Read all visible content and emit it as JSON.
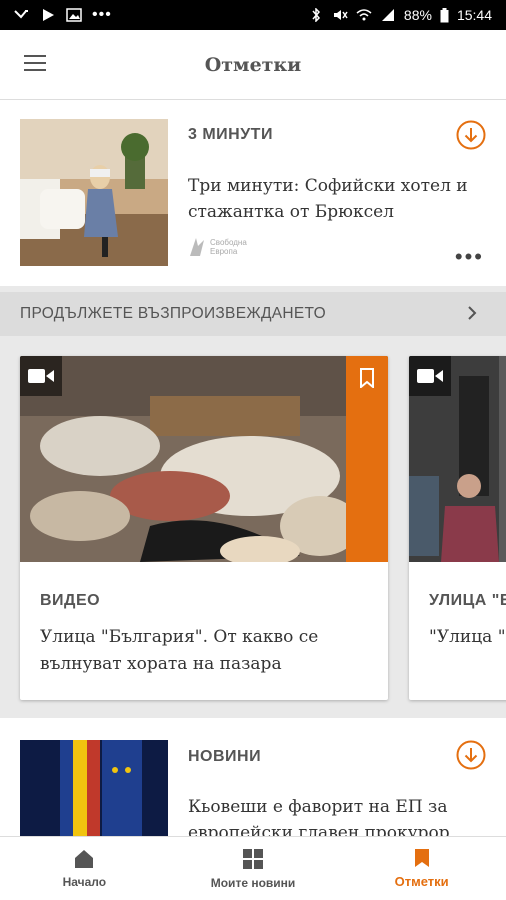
{
  "status_bar": {
    "battery": "88%",
    "time": "15:44"
  },
  "app_bar": {
    "title": "Отметки"
  },
  "first_story": {
    "category": "3 МИНУТИ",
    "title": "Три минути: Софийски хотел и стажантка от Брюксел",
    "source_line1": "Свободна",
    "source_line2": "Европа"
  },
  "continue_bar": {
    "label": "ПРОДЪЛЖЕТЕ ВЪЗПРОИЗВЕЖДАНЕТО"
  },
  "carousel": {
    "cards": [
      {
        "category": "ВИДЕО",
        "title": "Улица \"България\". От какво се вълнуват хората на пазара"
      },
      {
        "category": "УЛИЦА \"Б",
        "title": "\"Улица \"Б книжари"
      }
    ]
  },
  "second_story": {
    "category": "НОВИНИ",
    "title": "Кьовеши е фаворит на ЕП за европейски главен прокурор"
  },
  "bottom_nav": {
    "items": [
      {
        "label": "Начало"
      },
      {
        "label": "Моите новини"
      },
      {
        "label": "Отметки"
      }
    ]
  },
  "colors": {
    "accent": "#e46f10",
    "text": "#333333",
    "background": "#e9e9e9"
  }
}
